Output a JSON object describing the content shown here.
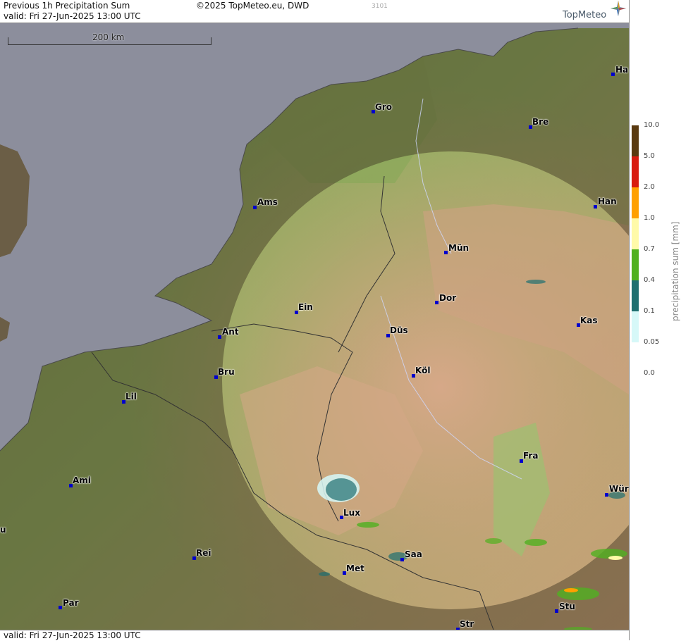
{
  "header": {
    "title": "Previous 1h Precipitation Sum",
    "valid": "valid:  Fri  27-Jun-2025 13:00 UTC",
    "copyright": "©2025 TopMeteo.eu, DWD",
    "code": "3101",
    "brand": "TopMeteo"
  },
  "footer": {
    "valid": "valid:  Fri  27-Jun-2025 13:00 UTC"
  },
  "scale_bar": {
    "label": "200 km"
  },
  "cities": [
    {
      "key": "ha",
      "name": "Ha"
    },
    {
      "key": "gro",
      "name": "Gro"
    },
    {
      "key": "bre",
      "name": "Bre"
    },
    {
      "key": "ams",
      "name": "Ams"
    },
    {
      "key": "han",
      "name": "Han"
    },
    {
      "key": "mun",
      "name": "Mün"
    },
    {
      "key": "dor",
      "name": "Dor"
    },
    {
      "key": "ein",
      "name": "Ein"
    },
    {
      "key": "kas",
      "name": "Kas"
    },
    {
      "key": "ant",
      "name": "Ant"
    },
    {
      "key": "dus",
      "name": "Düs"
    },
    {
      "key": "bru",
      "name": "Bru"
    },
    {
      "key": "kol",
      "name": "Köl"
    },
    {
      "key": "lil",
      "name": "Lil"
    },
    {
      "key": "fra",
      "name": "Fra"
    },
    {
      "key": "ami",
      "name": "Ami"
    },
    {
      "key": "wur",
      "name": "Wür"
    },
    {
      "key": "lux",
      "name": "Lux"
    },
    {
      "key": "u",
      "name": "u"
    },
    {
      "key": "rei",
      "name": "Rei"
    },
    {
      "key": "saa",
      "name": "Saa"
    },
    {
      "key": "met",
      "name": "Met"
    },
    {
      "key": "par",
      "name": "Par"
    },
    {
      "key": "stu",
      "name": "Stu"
    },
    {
      "key": "str",
      "name": "Str"
    }
  ],
  "legend": {
    "title": "precipitation sum [mm]",
    "labels": [
      "10.0",
      "5.0",
      "2.0",
      "1.0",
      "0.7",
      "0.4",
      "0.1",
      "0.05",
      "0.0"
    ],
    "colors": [
      "#5a3a10",
      "#d81c10",
      "#ffa000",
      "#fffaa8",
      "#50b020",
      "#1f6f70",
      "#d6f8f8"
    ]
  },
  "colors": {
    "sea": "#8c8e9c",
    "radar_ring_sea": "#dcdcee",
    "lowland": "#6a5a3a",
    "green": "#5e9a48",
    "hills": "#c8a078"
  }
}
